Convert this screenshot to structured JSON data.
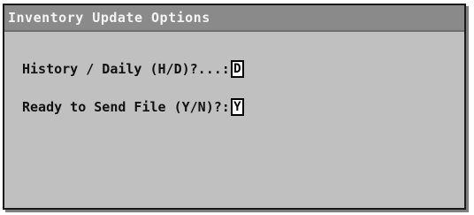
{
  "window": {
    "title": "Inventory Update Options"
  },
  "form": {
    "history_daily": {
      "label": "History / Daily (H/D)?...:",
      "value": "D"
    },
    "ready_to_send": {
      "label": "Ready to Send File (Y/N)?:",
      "value": "Y"
    }
  },
  "colors": {
    "title_bar": "#8a8a8a",
    "window_bg": "#c0c0c0",
    "field_bg": "#ffffff"
  }
}
